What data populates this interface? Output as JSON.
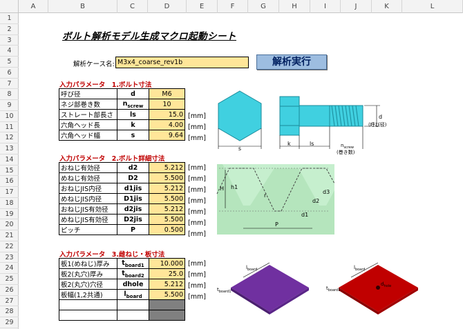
{
  "columns": [
    "A",
    "B",
    "C",
    "D",
    "E",
    "F",
    "G",
    "H",
    "I",
    "J",
    "K",
    "L"
  ],
  "rows": [
    "1",
    "2",
    "3",
    "4",
    "5",
    "6",
    "7",
    "8",
    "9",
    "10",
    "11",
    "12",
    "13",
    "14",
    "15",
    "16",
    "17",
    "18",
    "19",
    "20",
    "21",
    "22",
    "23",
    "24",
    "25",
    "26",
    "27",
    "28",
    "29"
  ],
  "title": "ボルト解析モデル生成マクロ起動シート",
  "case": {
    "label": "解析ケース名:",
    "value": "M3x4_coarse_rev1b"
  },
  "run_button": "解析実行",
  "section1": {
    "header": "入力パラメータ　1.ボルト寸法",
    "rows": [
      {
        "name": "呼び径",
        "sym": "d",
        "sub": "",
        "value": "M6",
        "unit": ""
      },
      {
        "name": "ネジ部巻き数",
        "sym": "n",
        "sub": "screw",
        "value": "10",
        "unit": ""
      },
      {
        "name": "ストレート部長さ",
        "sym": "ls",
        "sub": "",
        "value": "15.0",
        "unit": "[mm]"
      },
      {
        "name": "六角ヘッド長",
        "sym": "k",
        "sub": "",
        "value": "4.00",
        "unit": "[mm]"
      },
      {
        "name": "六角ヘッド幅",
        "sym": "s",
        "sub": "",
        "value": "9.64",
        "unit": "[mm]"
      }
    ]
  },
  "section2": {
    "header": "入力パラメータ　2.ボルト詳細寸法",
    "rows": [
      {
        "name": "おねじ有効径",
        "sym": "d2",
        "value": "5.212",
        "unit": "[mm]"
      },
      {
        "name": "めねじ有効径",
        "sym": "D2",
        "value": "5.500",
        "unit": "[mm]"
      },
      {
        "name": "おねじJIS内径",
        "sym": "d1jis",
        "value": "5.212",
        "unit": "[mm]"
      },
      {
        "name": "めねじJIS内径",
        "sym": "D1jis",
        "value": "5.500",
        "unit": "[mm]"
      },
      {
        "name": "おねじJIS有効径",
        "sym": "d2jis",
        "value": "5.212",
        "unit": "[mm]"
      },
      {
        "name": "めねじJIS有効径",
        "sym": "D2jis",
        "value": "5.500",
        "unit": "[mm]"
      },
      {
        "name": "ピッチ",
        "sym": "P",
        "value": "0.500",
        "unit": "[mm]"
      }
    ]
  },
  "section3": {
    "header": "入力パラメータ　3.雌ねじ・板寸法",
    "rows": [
      {
        "name": "板1(めねじ)厚み",
        "sym": "t",
        "sub": "board1",
        "value": "10.000",
        "unit": "[mm]"
      },
      {
        "name": "板2(丸穴)厚み",
        "sym": "t",
        "sub": "board2",
        "value": "25.0",
        "unit": "[mm]"
      },
      {
        "name": "板2(丸穴)穴径",
        "sym": "dhole",
        "sub": "",
        "value": "5.212",
        "unit": "[mm]"
      },
      {
        "name": "板幅(1,2共通)",
        "sym": "l",
        "sub": "board",
        "value": "5.500",
        "unit": "[mm]"
      }
    ]
  },
  "diagram_labels": {
    "s": "s",
    "k": "k",
    "ls": "ls",
    "d": "d",
    "d_note": "(呼び径)",
    "nscrew": "n",
    "nscrew_sub": "screw",
    "nscrew_note": "(巻き数)",
    "H": "H",
    "h1": "h1",
    "d3": "d3",
    "d2": "d2",
    "d1": "d1",
    "P": "P",
    "lboard": "l",
    "lboard_sub": "board",
    "tboard": "t",
    "tboard_sub": "board1",
    "dhole": "d",
    "dhole_sub": "hole"
  },
  "colors": {
    "input_fill": "#ffe699",
    "bolt": "#40d0e0",
    "thread": "#c6efce",
    "plate1": "#7030a0",
    "plate2": "#c00000",
    "section_red": "#c00000"
  }
}
